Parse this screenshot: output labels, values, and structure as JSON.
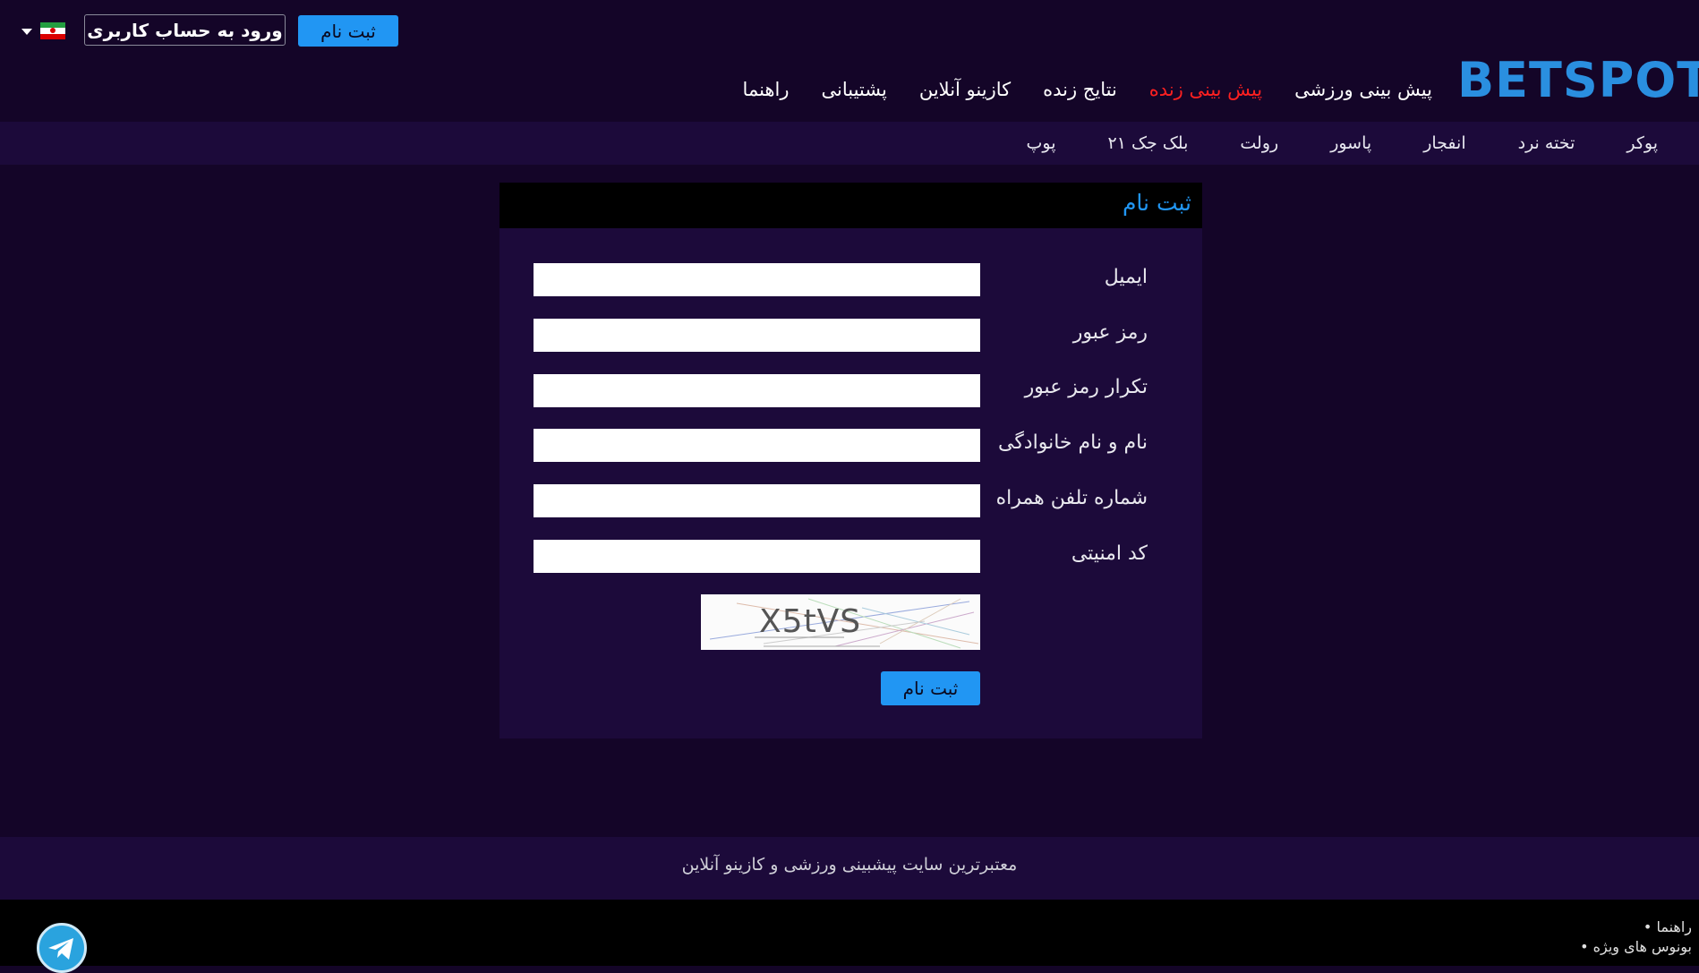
{
  "topbar": {
    "register_label": "ثبت نام",
    "login_label": "ورود به حساب کاربری",
    "language_flag": "iran-flag-icon"
  },
  "brand": {
    "logo_text": "BETSPOT",
    "color": "#2a8fe0"
  },
  "main_nav": {
    "items": [
      {
        "label": "پیش بینی ورزشی",
        "active": false
      },
      {
        "label": "پیش بینی زنده",
        "active": true
      },
      {
        "label": "نتایج زنده",
        "active": false
      },
      {
        "label": "کازینو آنلاین",
        "active": false
      },
      {
        "label": "پشتیبانی",
        "active": false
      },
      {
        "label": "راهنما",
        "active": false
      }
    ]
  },
  "sub_nav": {
    "items": [
      "پوکر",
      "تخته نرد",
      "انفجار",
      "پاسور",
      "رولت",
      "بلک جک ۲۱",
      "پوپ"
    ]
  },
  "form": {
    "title": "ثبت نام",
    "fields": [
      {
        "label": "ایمیل",
        "value": "",
        "placeholder": ""
      },
      {
        "label": "رمز عبور",
        "value": "",
        "placeholder": ""
      },
      {
        "label": "تکرار رمز عبور",
        "value": "",
        "placeholder": ""
      },
      {
        "label": "نام و نام خانوادگی",
        "value": "",
        "placeholder": ""
      },
      {
        "label": "شماره تلفن همراه",
        "value": "",
        "placeholder": ""
      },
      {
        "label": "کد امنیتی",
        "value": "",
        "placeholder": ""
      }
    ],
    "captcha_text": "X5tVS",
    "submit_label": "ثبت نام"
  },
  "footer": {
    "tagline": "معتبرترین سایت پیشبینی ورزشی و کازینو آنلاین",
    "links": [
      "• راهنما",
      "• بونوس های ویژه"
    ]
  },
  "colors": {
    "accent": "#2196f3",
    "active_nav": "#ff2020",
    "background": "#140528",
    "panel": "#1c0a3a"
  }
}
